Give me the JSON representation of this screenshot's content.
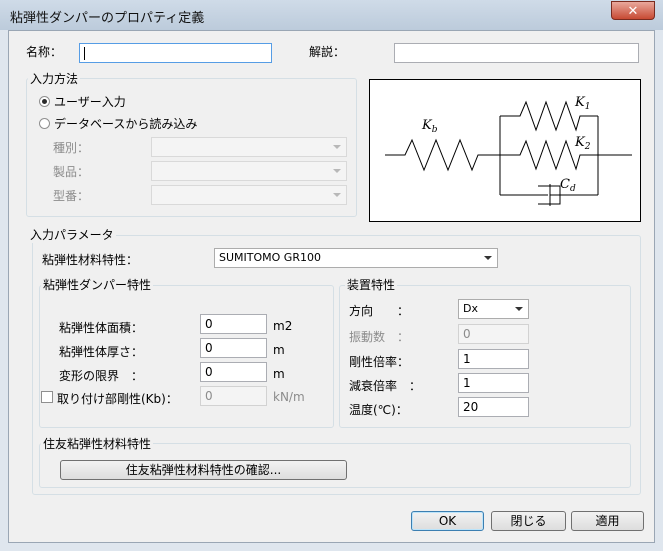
{
  "window": {
    "title": "粘弾性ダンパーのプロパティ定義",
    "close_glyph": "✕"
  },
  "name_field": {
    "label": "名称：",
    "value": ""
  },
  "desc_field": {
    "label": "解説：",
    "value": ""
  },
  "input_method": {
    "title": "入力方法",
    "options": [
      {
        "label": "ユーザー入力",
        "selected": true
      },
      {
        "label": "データベースから読み込み",
        "selected": false
      }
    ],
    "fields": [
      {
        "label": "種別：",
        "value": ""
      },
      {
        "label": "製品：",
        "value": ""
      },
      {
        "label": "型番：",
        "value": ""
      }
    ]
  },
  "diagram": {
    "k_b": "K",
    "k_b_sub": "b",
    "k_1": "K",
    "k_1_sub": "1",
    "k_2": "K",
    "k_2_sub": "2",
    "c_d": "C",
    "c_d_sub": "d"
  },
  "params": {
    "title": "入力パラメータ",
    "material_label": "粘弾性材料特性：",
    "material_value": "SUMITOMO GR100",
    "damper": {
      "title": "粘弾性ダンパー特性",
      "rows": [
        {
          "label": "粘弾性体面積：",
          "value": "0",
          "unit": "m2"
        },
        {
          "label": "粘弾性体厚さ：",
          "value": "0",
          "unit": "m"
        },
        {
          "label": "変形の限界　：",
          "value": "0",
          "unit": "m"
        }
      ],
      "stiffness": {
        "label": "取り付け部剛性(Kb)：",
        "value": "0",
        "unit": "kN/m",
        "checked": false
      }
    },
    "device": {
      "title": "装置特性",
      "direction_label": "方向　　：",
      "direction_value": "Dx",
      "freq_label": "振動数　：",
      "freq_value": "0",
      "stiff_mult_label": "剛性倍率：",
      "stiff_mult_value": "1",
      "damp_mult_label": "減衰倍率　：",
      "damp_mult_value": "1",
      "temp_label": "温度(℃)：",
      "temp_value": "20"
    }
  },
  "sumitomo": {
    "title": "住友粘弾性材料特性",
    "button": "住友粘弾性材料特性の確認..."
  },
  "buttons": {
    "ok": "OK",
    "close": "閉じる",
    "apply": "適用"
  }
}
